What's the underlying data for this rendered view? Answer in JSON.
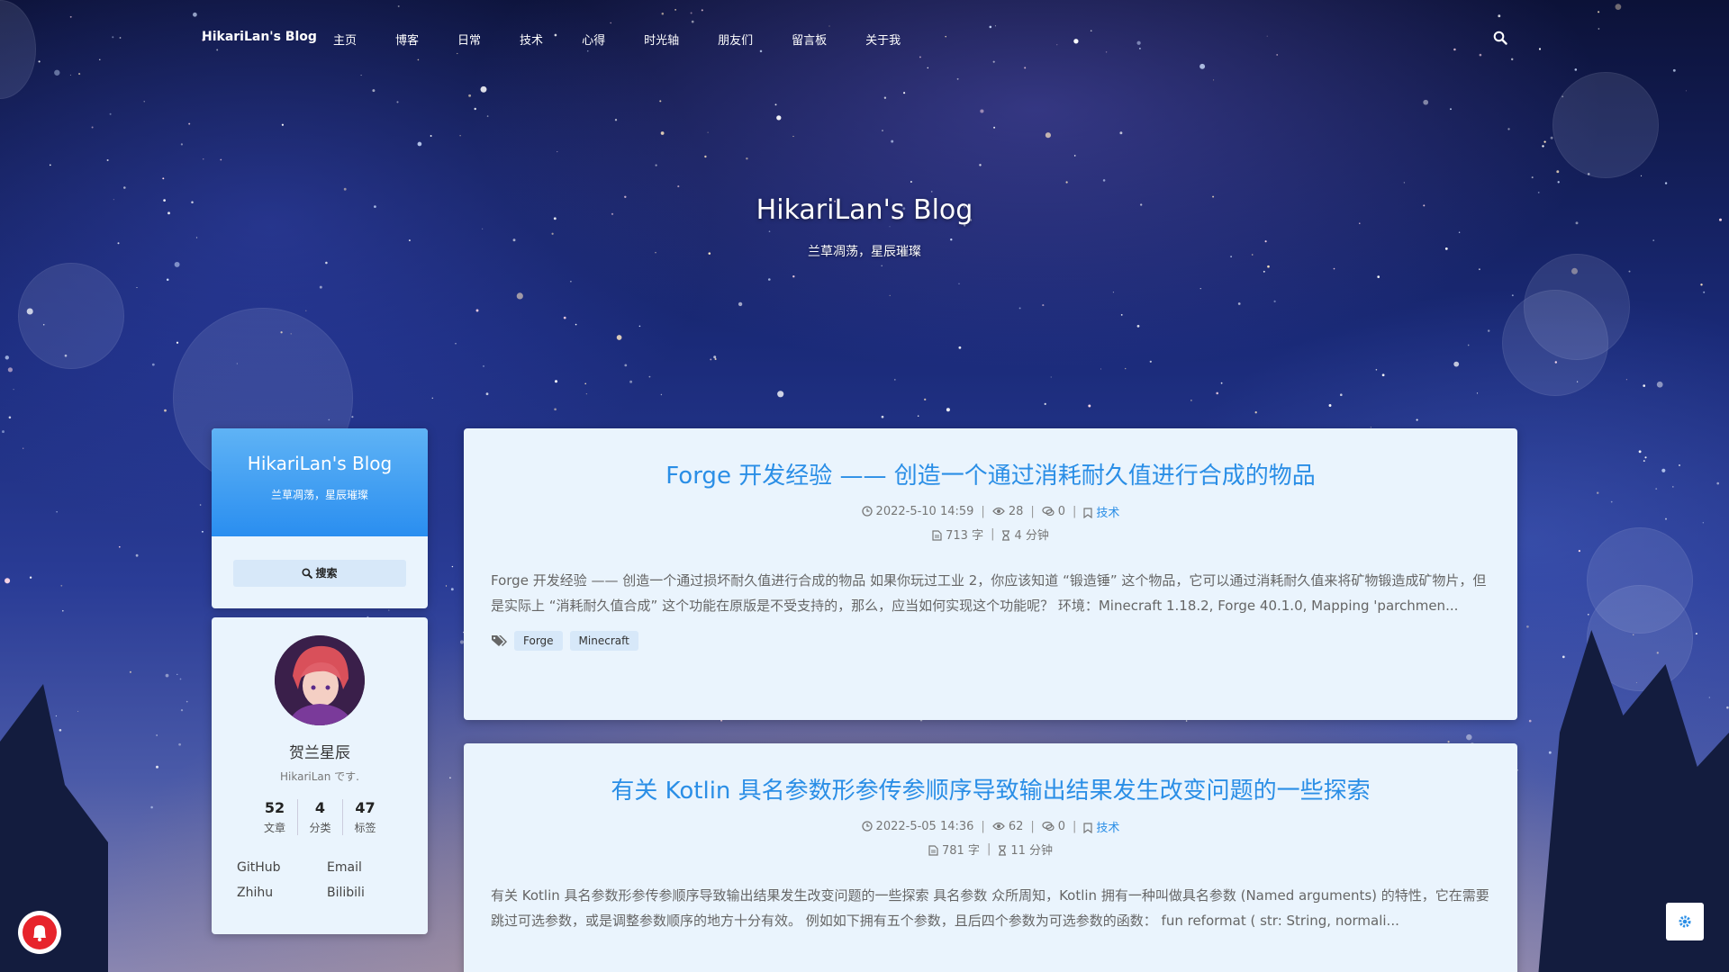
{
  "nav": {
    "brand": "HikariLan's Blog",
    "items": [
      "主页",
      "博客",
      "日常",
      "技术",
      "心得",
      "时光轴",
      "朋友们",
      "留言板",
      "关于我"
    ]
  },
  "hero": {
    "title": "HikariLan's Blog",
    "subtitle": "兰草凋荡，星辰璀璨"
  },
  "sidebar": {
    "brand_title": "HikariLan's Blog",
    "brand_subtitle": "兰草凋荡，星辰璀璨",
    "search_label": "搜索",
    "author_name": "贺兰星辰",
    "author_desc": "HikariLan です.",
    "stats": [
      {
        "num": "52",
        "label": "文章"
      },
      {
        "num": "4",
        "label": "分类"
      },
      {
        "num": "47",
        "label": "标签"
      }
    ],
    "links": [
      "GitHub",
      "Email",
      "Zhihu",
      "Bilibili"
    ]
  },
  "posts": [
    {
      "title": "Forge 开发经验 —— 创造一个通过消耗耐久值进行合成的物品",
      "date": "2022-5-10 14:59",
      "views": "28",
      "comments": "0",
      "category": "技术",
      "words": "713 字",
      "read_time": "4 分钟",
      "excerpt": "Forge 开发经验 —— 创造一个通过损坏耐久值进行合成的物品 如果你玩过工业 2，你应该知道 “锻造锤” 这个物品，它可以通过消耗耐久值来将矿物锻造成矿物片，但是实际上 “消耗耐久值合成” 这个功能在原版是不受支持的，那么，应当如何实现这个功能呢？ 环境：Minecraft 1.18.2, Forge 40.1.0, Mapping 'parchmen...",
      "tags": [
        "Forge",
        "Minecraft"
      ]
    },
    {
      "title": "有关 Kotlin 具名参数形参传参顺序导致输出结果发生改变问题的一些探索",
      "date": "2022-5-05 14:36",
      "views": "62",
      "comments": "0",
      "category": "技术",
      "words": "781 字",
      "read_time": "11 分钟",
      "excerpt": "有关 Kotlin 具名参数形参传参顺序导致输出结果发生改变问题的一些探索 具名参数 众所周知，Kotlin 拥有一种叫做具名参数 (Named arguments) 的特性，它在需要跳过可选参数，或是调整参数顺序的地方十分有效。 例如如下拥有五个参数，且后四个参数为可选参数的函数： fun reformat ( str: String, normali..."
    }
  ],
  "colors": {
    "accent": "#2a8ee6",
    "card_bg": "#eaf4fd",
    "notify_red": "#e7242b"
  },
  "icons": [
    "search-icon",
    "clock-icon",
    "eye-icon",
    "comment-icon",
    "bookmark-icon",
    "document-icon",
    "hourglass-icon",
    "tags-icon",
    "bell-icon",
    "gear-icon"
  ]
}
